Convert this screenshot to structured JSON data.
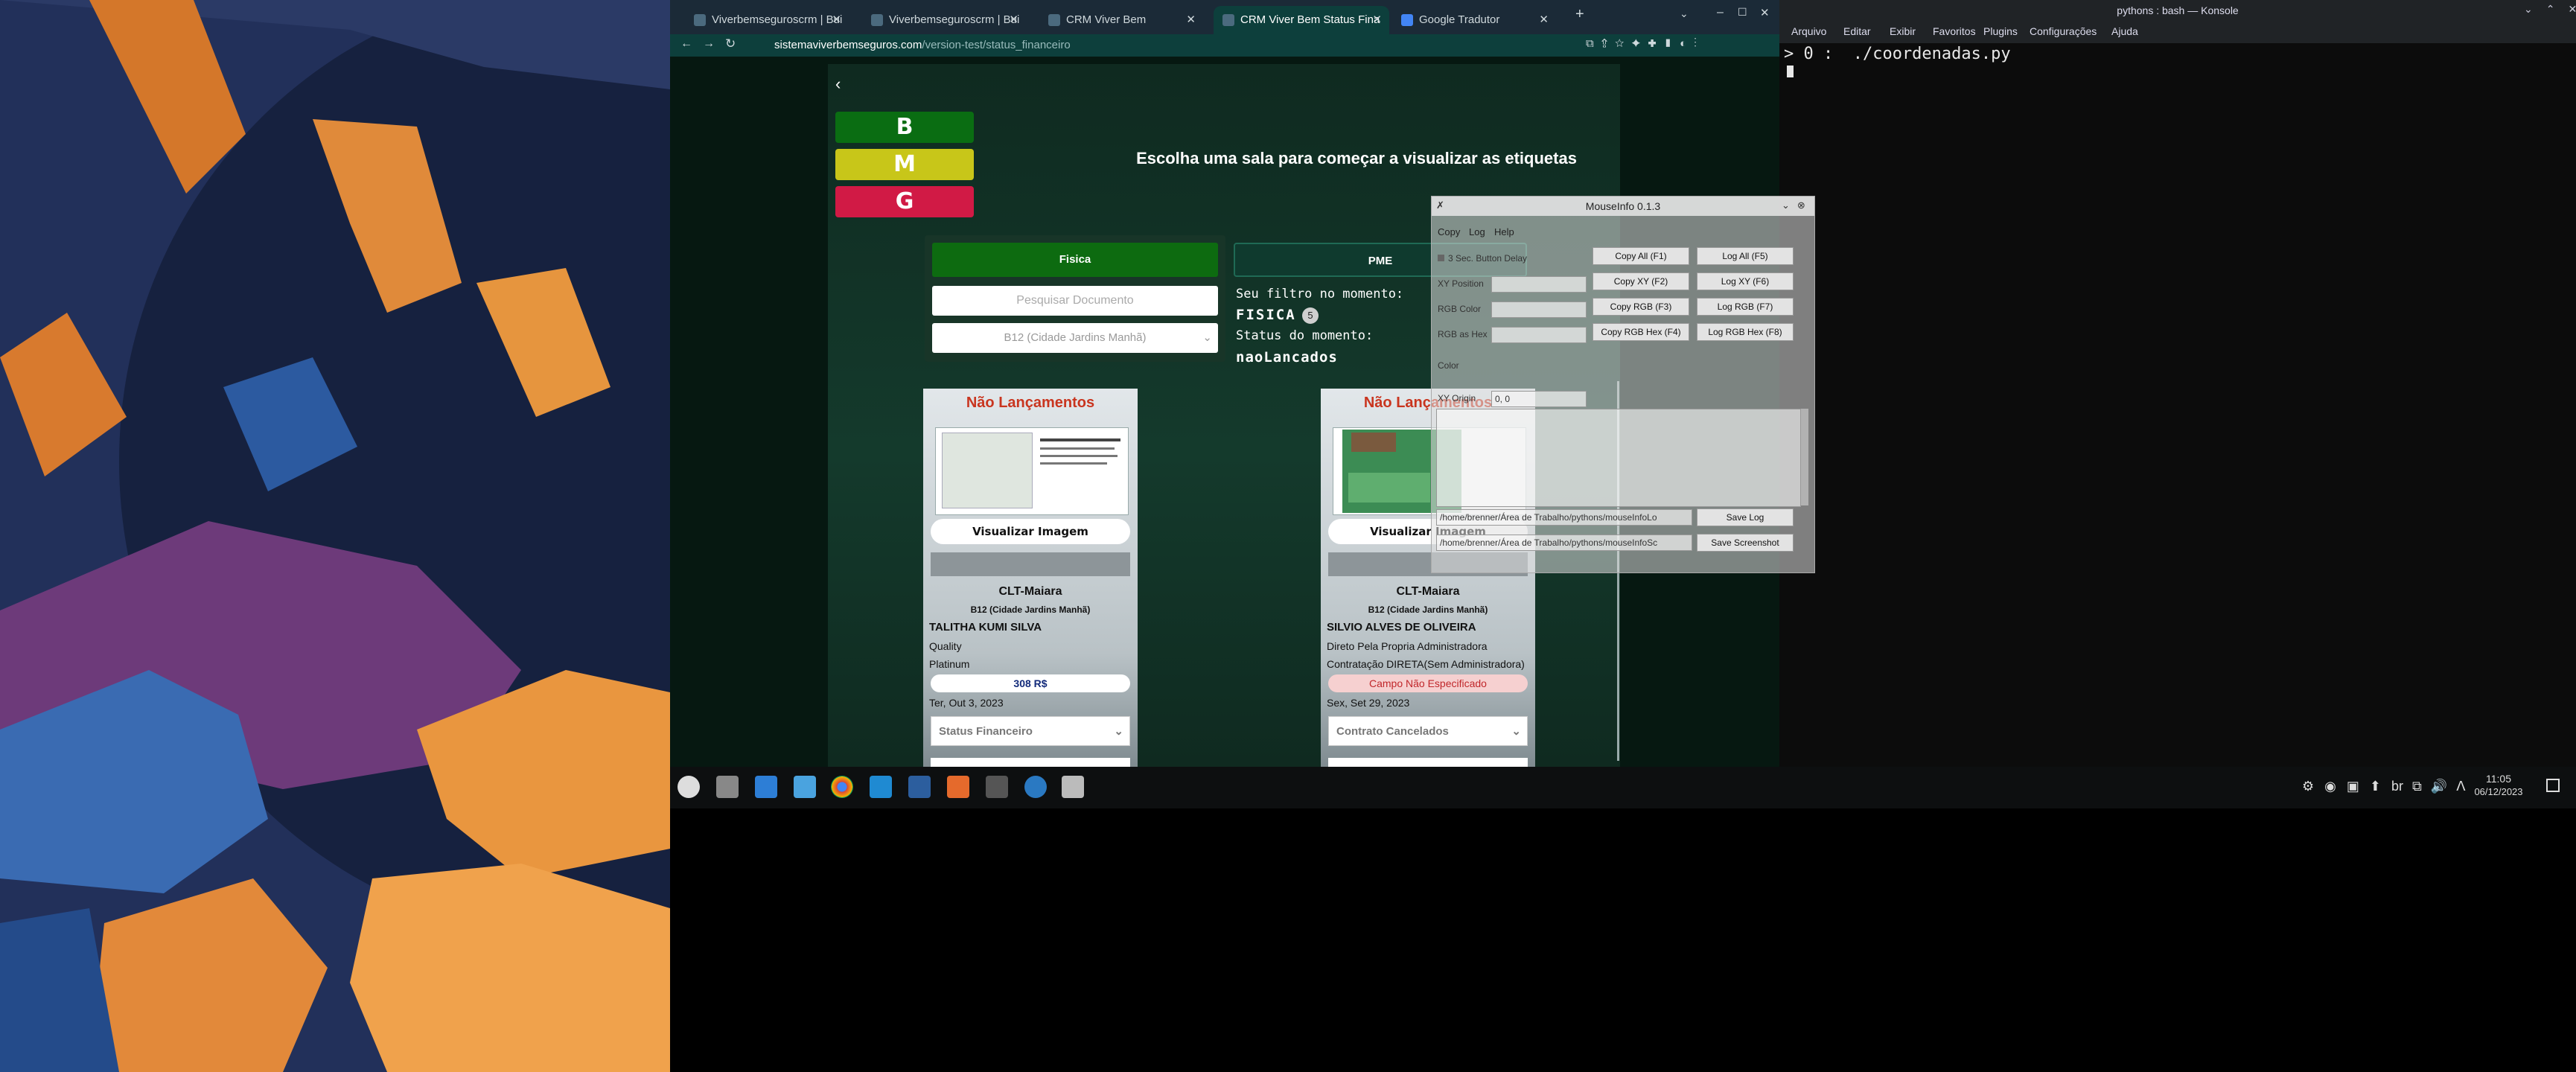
{
  "browser": {
    "tabs": [
      {
        "label": "Viverbemseguroscrm | Bui"
      },
      {
        "label": "Viverbemseguroscrm | Bui"
      },
      {
        "label": "CRM Viver Bem"
      },
      {
        "label": "CRM Viver Bem Status Fina"
      },
      {
        "label": "Google Tradutor"
      }
    ],
    "url_domain": "sistemaviverbemseguros.com",
    "url_path": "/version-test/status_financeiro"
  },
  "app": {
    "back_icon": "chevron-left-icon",
    "room_buttons": [
      {
        "label": "B",
        "color": "#0a6d12"
      },
      {
        "label": "M",
        "color": "#c8c619"
      },
      {
        "label": "G",
        "color": "#d11a45"
      }
    ],
    "welcome": "Escolha uma sala para começar a visualizar as etiquetas",
    "filter": {
      "fisica_label": "Fisica",
      "pme_label": "PME",
      "search_placeholder": "Pesquisar Documento",
      "location_value": "B12 (Cidade Jardins Manhã)"
    },
    "status": {
      "filter_label": "Seu filtro no momento:",
      "filter_value": "FISICA",
      "filter_count": "5",
      "status_label": "Status do momento:",
      "status_value": "naoLancados"
    },
    "cards": [
      {
        "title": "Não Lançamentos",
        "view_button": "Visualizar Imagem",
        "type": "CLT-Maiara",
        "location": "B12 (Cidade Jardins Manhã)",
        "name": "TALITHA KUMI SILVA",
        "line1": "Quality",
        "line2": "Platinum",
        "pill": "308 R$",
        "date": "Ter, Out 3, 2023",
        "select": "Status Financeiro"
      },
      {
        "title": "Não Lançamentos",
        "view_button": "Visualizar Imagem",
        "type": "CLT-Maiara",
        "location": "B12 (Cidade Jardins Manhã)",
        "name": "SILVIO ALVES DE OLIVEIRA",
        "line1": "Direto Pela Propria Administradora",
        "line2": "Contratação DIRETA(Sem Administradora)",
        "pill": "Campo Não Especificado",
        "date": "Sex, Set 29, 2023",
        "select": "Contrato Cancelados"
      }
    ]
  },
  "mouseinfo": {
    "title": "MouseInfo 0.1.3",
    "menu": [
      "Copy",
      "Log",
      "Help"
    ],
    "delay_label": "3 Sec. Button Delay",
    "labels": [
      "XY Position",
      "RGB Color",
      "RGB as Hex",
      "Color",
      "XY Origin"
    ],
    "xy_origin_value": "0, 0",
    "buttons": [
      [
        "Copy All (F1)",
        "Log All (F5)"
      ],
      [
        "Copy XY (F2)",
        "Log XY (F6)"
      ],
      [
        "Copy RGB (F3)",
        "Log RGB (F7)"
      ],
      [
        "Copy RGB Hex (F4)",
        "Log RGB Hex (F8)"
      ]
    ],
    "log_path": "/home/brenner/Área de Trabalho/pythons/mouseInfoLo",
    "screenshot_path": "/home/brenner/Área de Trabalho/pythons/mouseInfoSc",
    "save_log": "Save Log",
    "save_screenshot": "Save Screenshot"
  },
  "konsole": {
    "title": "pythons : bash — Konsole",
    "menu": [
      "Arquivo",
      "Editar",
      "Exibir",
      "Favoritos",
      "Plugins",
      "Configurações",
      "Ajuda"
    ],
    "line": "> 0 :  ./coordenadas.py"
  },
  "taskbar": {
    "layout": "br",
    "time": "11:05",
    "date": "06/12/2023"
  }
}
